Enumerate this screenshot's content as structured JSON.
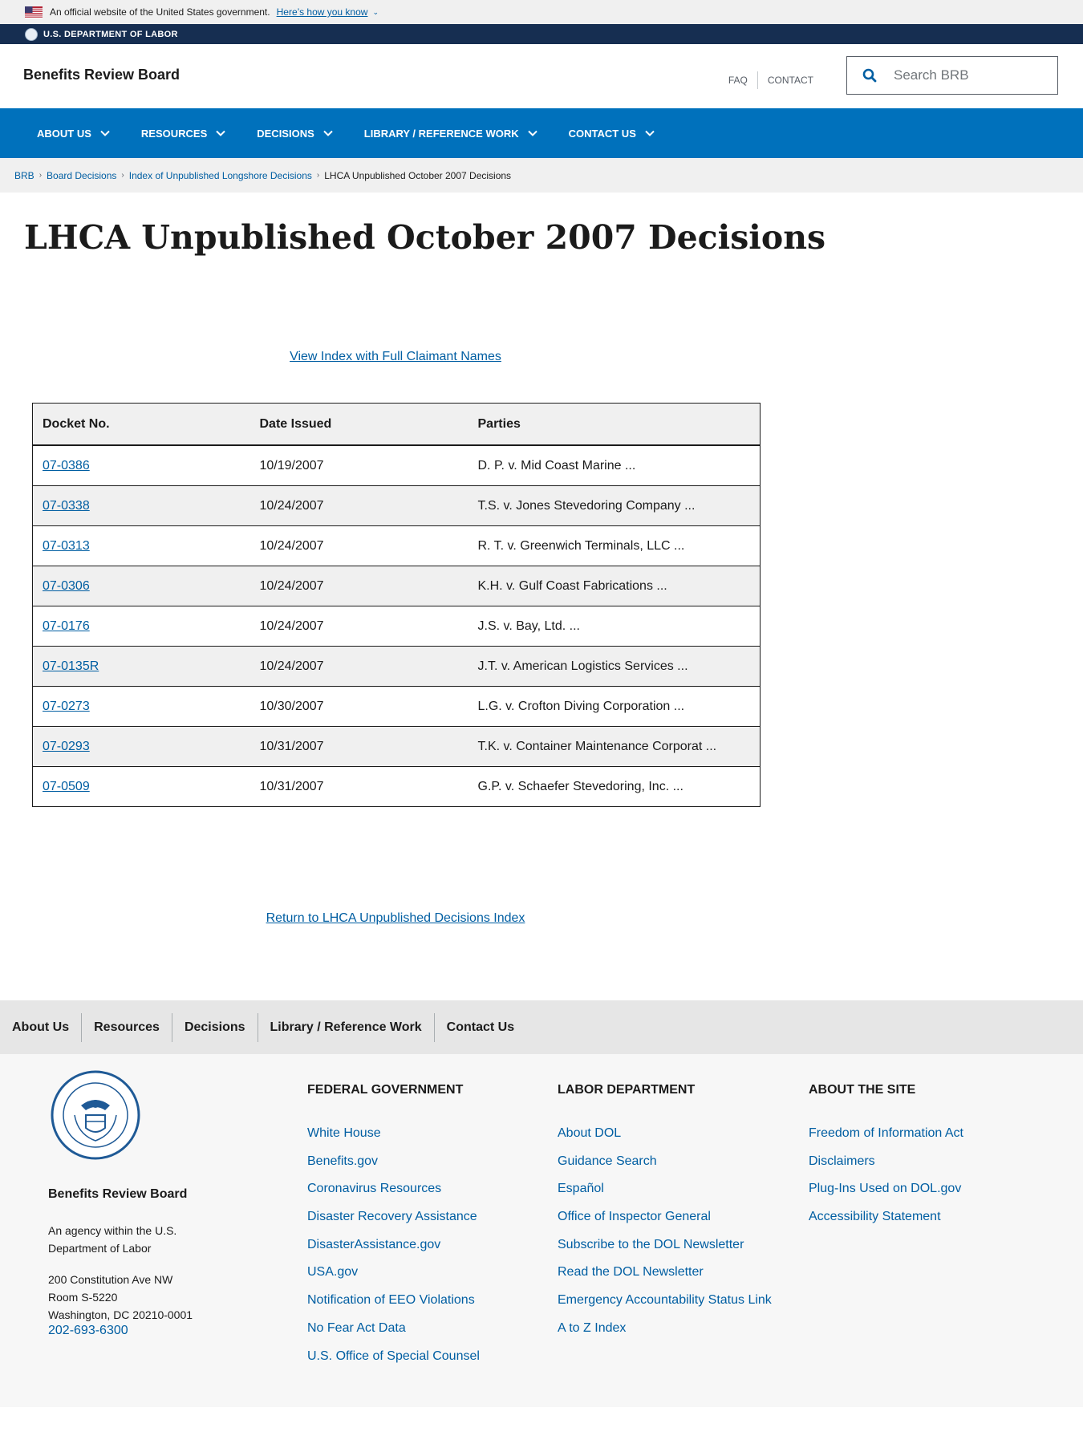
{
  "gov_banner": {
    "text": "An official website of the United States government.",
    "link": "Here’s how you know"
  },
  "agency_bar": {
    "label": "U.S. DEPARTMENT OF LABOR"
  },
  "header": {
    "site_title": "Benefits Review Board",
    "util_links": [
      "FAQ",
      "CONTACT"
    ],
    "search_placeholder": "Search BRB"
  },
  "nav": {
    "items": [
      "ABOUT US",
      "RESOURCES",
      "DECISIONS",
      "LIBRARY / REFERENCE WORK",
      "CONTACT US"
    ]
  },
  "breadcrumb": {
    "items": [
      "BRB",
      "Board Decisions",
      "Index of Unpublished Longshore Decisions"
    ],
    "current": "LHCA Unpublished October 2007 Decisions"
  },
  "main": {
    "title": "LHCA Unpublished October 2007 Decisions",
    "index_link": "View Index with Full Claimant Names",
    "table": {
      "headers": [
        "Docket No.",
        "Date Issued",
        "Parties"
      ],
      "rows": [
        {
          "docket": "07-0386",
          "date": "10/19/2007",
          "parties": "D. P. v. Mid Coast Marine ..."
        },
        {
          "docket": "07-0338",
          "date": "10/24/2007",
          "parties": "T.S. v. Jones Stevedoring Company ..."
        },
        {
          "docket": "07-0313",
          "date": "10/24/2007",
          "parties": "R. T. v. Greenwich Terminals, LLC ..."
        },
        {
          "docket": "07-0306",
          "date": "10/24/2007",
          "parties": "K.H. v. Gulf Coast Fabrications ..."
        },
        {
          "docket": "07-0176",
          "date": "10/24/2007",
          "parties": "J.S. v. Bay, Ltd. ..."
        },
        {
          "docket": "07-0135R",
          "date": "10/24/2007",
          "parties": "J.T. v. American Logistics Services ..."
        },
        {
          "docket": "07-0273",
          "date": "10/30/2007",
          "parties": "L.G. v. Crofton Diving Corporation ..."
        },
        {
          "docket": "07-0293",
          "date": "10/31/2007",
          "parties": "T.K. v. Container Maintenance Corporat ..."
        },
        {
          "docket": "07-0509",
          "date": "10/31/2007",
          "parties": "G.P. v. Schaefer Stevedoring, Inc. ..."
        }
      ]
    },
    "return_link": "Return to LHCA Unpublished Decisions Index"
  },
  "footer_nav": {
    "items": [
      "About Us",
      "Resources",
      "Decisions",
      "Library / Reference Work",
      "Contact Us"
    ]
  },
  "footer": {
    "agency_name": "Benefits Review Board",
    "agency_desc": "An agency within the U.S. Department of Labor",
    "address": [
      "200 Constitution Ave NW",
      "Room S-5220",
      "Washington, DC 20210-0001"
    ],
    "phone": "202-693-6300",
    "columns": [
      {
        "heading": "FEDERAL GOVERNMENT",
        "links": [
          "White House",
          "Benefits.gov",
          "Coronavirus Resources",
          "Disaster Recovery Assistance",
          "DisasterAssistance.gov",
          "USA.gov",
          "Notification of EEO Violations",
          "No Fear Act Data",
          "U.S. Office of Special Counsel"
        ]
      },
      {
        "heading": "LABOR DEPARTMENT",
        "links": [
          "About DOL",
          "Guidance Search",
          "Español",
          "Office of Inspector General",
          "Subscribe to the DOL Newsletter",
          "Read the DOL Newsletter",
          "Emergency Accountability Status Link",
          "A to Z Index"
        ]
      },
      {
        "heading": "ABOUT THE SITE",
        "links": [
          "Freedom of Information Act",
          "Disclaimers",
          "Plug-Ins Used on DOL.gov",
          "Accessibility Statement"
        ]
      }
    ]
  },
  "colors": {
    "nav_blue": "#0071bc",
    "agency_bar_navy": "#162e51",
    "link_blue": "#005ea2"
  }
}
